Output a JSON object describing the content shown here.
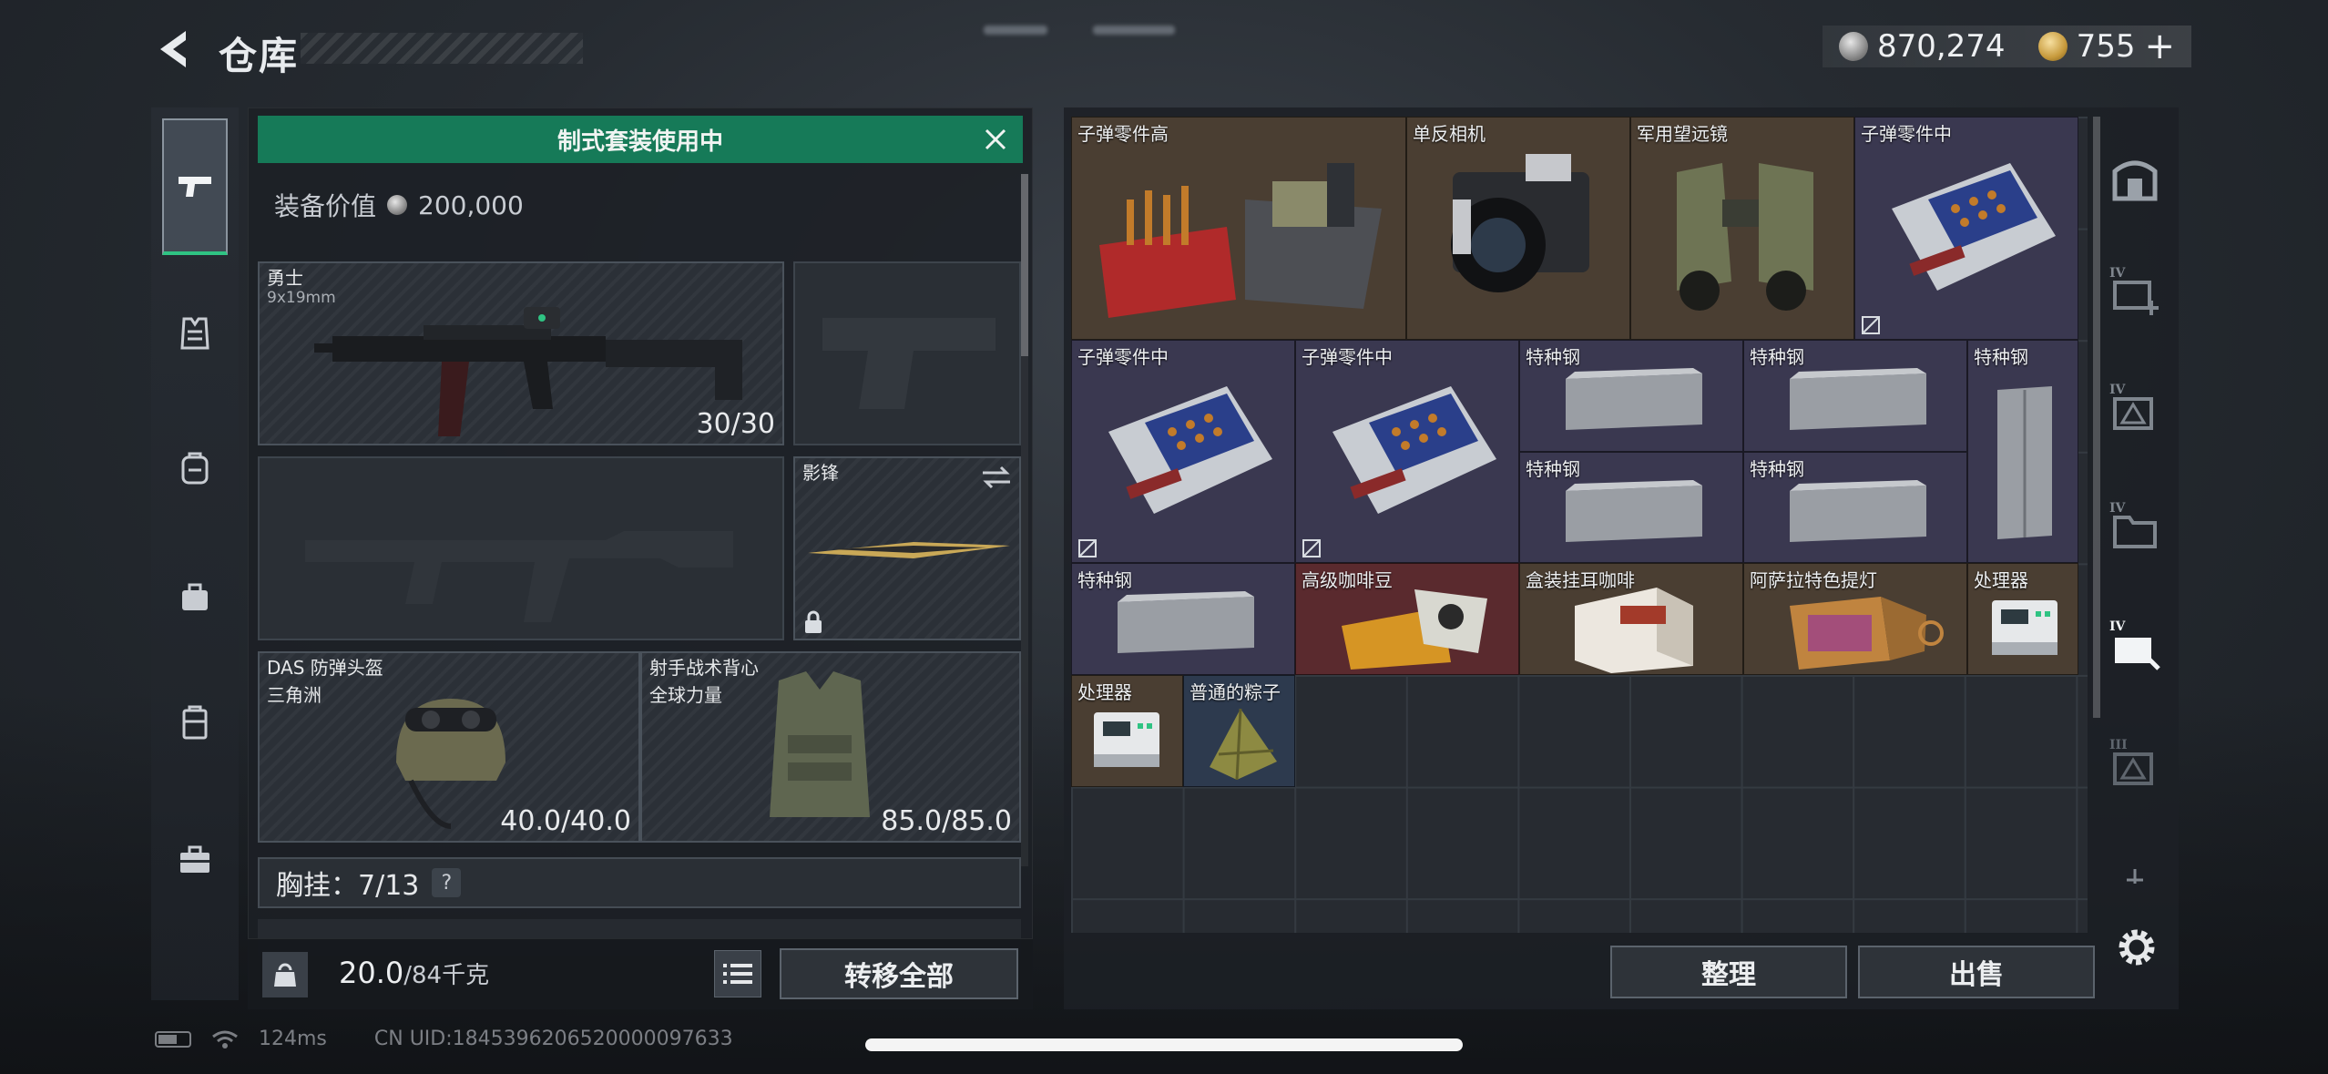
{
  "header": {
    "title": "仓库",
    "currency": [
      {
        "icon": "silver-coin-icon",
        "value": "870,274"
      },
      {
        "icon": "gold-coin-icon",
        "value": "755"
      }
    ],
    "add_label": "+"
  },
  "left_sidebar": {
    "items": [
      {
        "name": "weapons",
        "icon": "pistol-icon",
        "active": true
      },
      {
        "name": "armor",
        "icon": "vest-icon"
      },
      {
        "name": "helmet",
        "icon": "backpack-icon"
      },
      {
        "name": "bag",
        "icon": "bag-icon"
      },
      {
        "name": "case",
        "icon": "case-icon"
      },
      {
        "name": "toolbox",
        "icon": "toolbox-icon"
      }
    ]
  },
  "equipment": {
    "banner": "制式套装使用中",
    "value_label": "装备价值",
    "value": "200,000",
    "primary_weapon": {
      "name": "勇士",
      "caliber": "9x19mm",
      "ammo": "30/30"
    },
    "melee": {
      "name": "影锋"
    },
    "helmet": {
      "name": "DAS 防弹头盔",
      "sub": "三角洲",
      "durability": "40.0/40.0"
    },
    "vest": {
      "name": "射手战术背心",
      "sub": "全球力量",
      "durability": "85.0/85.0"
    },
    "chest_rig": {
      "label": "胸挂：7/13",
      "help": "?"
    },
    "weight": {
      "current": "20.0",
      "max": "/84千克"
    },
    "transfer_all": "转移全部"
  },
  "warehouse": {
    "items": [
      {
        "name": "子弹零件高",
        "quality": "brown",
        "art": "ammo-crate"
      },
      {
        "name": "单反相机",
        "quality": "brown",
        "art": "camera"
      },
      {
        "name": "军用望远镜",
        "quality": "brown",
        "art": "binoculars"
      },
      {
        "name": "子弹零件中",
        "quality": "purple",
        "art": "ammo-tray"
      },
      {
        "name": "子弹零件中",
        "quality": "purple",
        "art": "ammo-tray"
      },
      {
        "name": "子弹零件中",
        "quality": "purple",
        "art": "ammo-tray"
      },
      {
        "name": "特种钢",
        "quality": "purple",
        "art": "steel"
      },
      {
        "name": "特种钢",
        "quality": "purple",
        "art": "steel"
      },
      {
        "name": "特种钢",
        "quality": "purple",
        "art": "steel-v"
      },
      {
        "name": "特种钢",
        "quality": "purple",
        "art": "steel"
      },
      {
        "name": "特种钢",
        "quality": "purple",
        "art": "steel"
      },
      {
        "name": "特种钢",
        "quality": "purple",
        "art": "steel"
      },
      {
        "name": "高级咖啡豆",
        "quality": "red",
        "art": "coffee-beans"
      },
      {
        "name": "盒装挂耳咖啡",
        "quality": "brown",
        "art": "coffee-box"
      },
      {
        "name": "阿萨拉特色提灯",
        "quality": "brown",
        "art": "lantern"
      },
      {
        "name": "处理器",
        "quality": "brown",
        "art": "processor"
      },
      {
        "name": "处理器",
        "quality": "brown",
        "art": "processor"
      },
      {
        "name": "普通的粽子",
        "quality": "blue",
        "art": "zongzi"
      }
    ],
    "sort_label": "整理",
    "sell_label": "出售"
  },
  "tier_sidebar": {
    "items": [
      {
        "label": "",
        "icon": "safe-icon"
      },
      {
        "label": "IV",
        "icon": "medkit-icon"
      },
      {
        "label": "IV",
        "icon": "gear-tier-icon"
      },
      {
        "label": "IV",
        "icon": "folder-icon"
      },
      {
        "label": "IV",
        "icon": "tools-icon",
        "active": true
      },
      {
        "label": "III",
        "icon": "gear-tier-icon"
      },
      {
        "label": "",
        "icon": "plus-icon"
      }
    ]
  },
  "status_bar": {
    "ping": "124ms",
    "uid": "CN UID:1845396206520000097633"
  },
  "colors": {
    "banner": "#167a58",
    "active_accent": "#2fc383",
    "quality_brown": "#4a3e32",
    "quality_purple": "#3a3850",
    "quality_blue": "#2d3a4e",
    "quality_red": "#5a2a2e"
  }
}
